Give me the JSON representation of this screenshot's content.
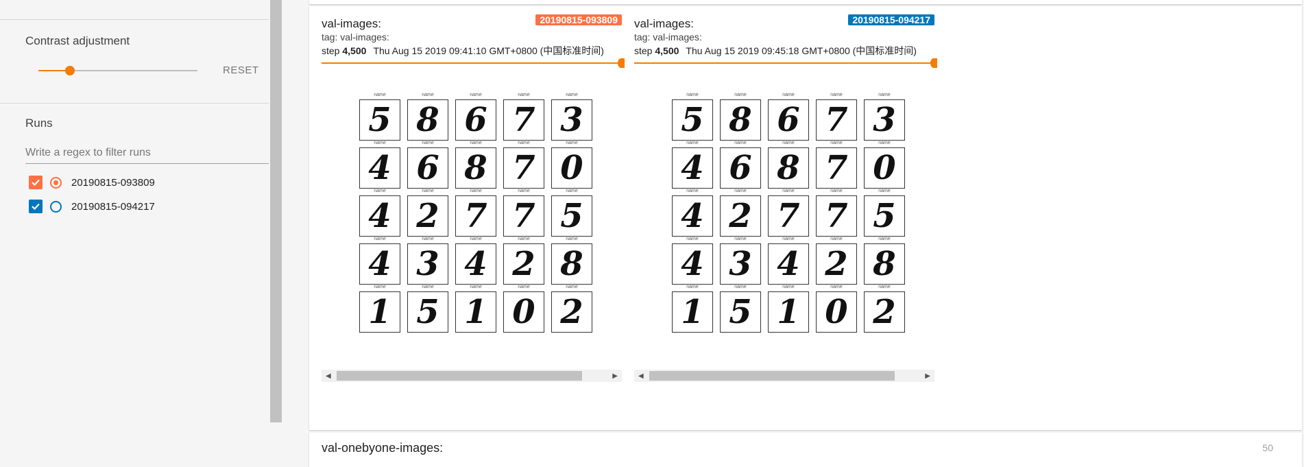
{
  "sidebar": {
    "contrast_title": "Contrast adjustment",
    "contrast_value": 0.2,
    "reset_label": "RESET",
    "runs_title": "Runs",
    "filter_placeholder": "Write a regex to filter runs",
    "runs": [
      {
        "name": "20190815-093809",
        "color": "#ff7043",
        "checked": true,
        "selected": true
      },
      {
        "name": "20190815-094217",
        "color": "#0077bb",
        "checked": true,
        "selected": false
      }
    ]
  },
  "panels": [
    {
      "run": "20190815-093809",
      "badge_color": "#ff7043",
      "title": "val-images:",
      "tag": "tag: val-images:",
      "step_label": "step",
      "step_value": "4,500",
      "date": "Thu Aug 15 2019 09:41:10 GMT+0800 (中国标准时间)"
    },
    {
      "run": "20190815-094217",
      "badge_color": "#0077bb",
      "title": "val-images:",
      "tag": "tag: val-images:",
      "step_label": "step",
      "step_value": "4,500",
      "date": "Thu Aug 15 2019 09:45:18 GMT+0800 (中国标准时间)"
    }
  ],
  "digits": [
    "5",
    "8",
    "6",
    "7",
    "3",
    "4",
    "6",
    "8",
    "7",
    "0",
    "4",
    "2",
    "7",
    "7",
    "5",
    "4",
    "3",
    "4",
    "2",
    "8",
    "1",
    "5",
    "1",
    "0",
    "2"
  ],
  "tile_caption": "name",
  "bottom": {
    "title": "val-onebyone-images:",
    "count": "50"
  },
  "colors": {
    "accent": "#f57c00"
  }
}
